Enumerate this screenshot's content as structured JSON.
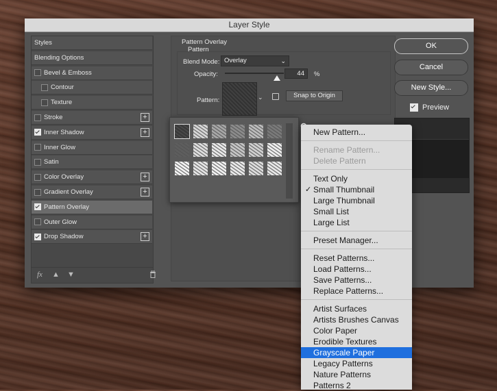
{
  "window": {
    "title": "Layer Style"
  },
  "styles_list": {
    "items": [
      {
        "label": "Styles",
        "checkbox": false,
        "checked": false,
        "plus": false,
        "indent": 0,
        "selected": false
      },
      {
        "label": "Blending Options",
        "checkbox": false,
        "checked": false,
        "plus": false,
        "indent": 0,
        "selected": false
      },
      {
        "label": "Bevel & Emboss",
        "checkbox": true,
        "checked": false,
        "plus": false,
        "indent": 0,
        "selected": false
      },
      {
        "label": "Contour",
        "checkbox": true,
        "checked": false,
        "plus": false,
        "indent": 1,
        "selected": false
      },
      {
        "label": "Texture",
        "checkbox": true,
        "checked": false,
        "plus": false,
        "indent": 1,
        "selected": false
      },
      {
        "label": "Stroke",
        "checkbox": true,
        "checked": false,
        "plus": true,
        "indent": 0,
        "selected": false
      },
      {
        "label": "Inner Shadow",
        "checkbox": true,
        "checked": true,
        "plus": true,
        "indent": 0,
        "selected": false
      },
      {
        "label": "Inner Glow",
        "checkbox": true,
        "checked": false,
        "plus": false,
        "indent": 0,
        "selected": false
      },
      {
        "label": "Satin",
        "checkbox": true,
        "checked": false,
        "plus": false,
        "indent": 0,
        "selected": false
      },
      {
        "label": "Color Overlay",
        "checkbox": true,
        "checked": false,
        "plus": true,
        "indent": 0,
        "selected": false
      },
      {
        "label": "Gradient Overlay",
        "checkbox": true,
        "checked": false,
        "plus": true,
        "indent": 0,
        "selected": false
      },
      {
        "label": "Pattern Overlay",
        "checkbox": true,
        "checked": true,
        "plus": false,
        "indent": 0,
        "selected": true
      },
      {
        "label": "Outer Glow",
        "checkbox": true,
        "checked": false,
        "plus": false,
        "indent": 0,
        "selected": false
      },
      {
        "label": "Drop Shadow",
        "checkbox": true,
        "checked": true,
        "plus": true,
        "indent": 0,
        "selected": false
      }
    ],
    "footer_fx": "fx"
  },
  "pattern_overlay": {
    "section_title": "Pattern Overlay",
    "group_title": "Pattern",
    "blend_mode_label": "Blend Mode:",
    "blend_mode_value": "Overlay",
    "opacity_label": "Opacity:",
    "opacity_value": "44",
    "opacity_unit": "%",
    "opacity_fraction": 0.44,
    "pattern_label": "Pattern:",
    "snap_button": "Snap to Origin"
  },
  "buttons": {
    "ok": "OK",
    "cancel": "Cancel",
    "new_style": "New Style...",
    "preview_label": "Preview",
    "preview_checked": true
  },
  "swatches": [
    "#3a3a3a",
    "#d8d8d8",
    "#a8a8a8",
    "#8c8c8c",
    "#bdbdbd",
    "#7a7a7a",
    "#5e5e5e",
    "#e0e0e0",
    "#eaeaea",
    "#c6c6c6",
    "#d2d2d2",
    "#f0f0f0",
    "#f4f4f4",
    "#e6e6e6",
    "#f2f2f2",
    "#ebebeb",
    "#dedede",
    "#e9e9e9"
  ],
  "menu": {
    "groups": [
      [
        {
          "label": "New Pattern...",
          "disabled": false
        }
      ],
      [
        {
          "label": "Rename Pattern...",
          "disabled": true
        },
        {
          "label": "Delete Pattern",
          "disabled": true
        }
      ],
      [
        {
          "label": "Text Only"
        },
        {
          "label": "Small Thumbnail",
          "checked": true
        },
        {
          "label": "Large Thumbnail"
        },
        {
          "label": "Small List"
        },
        {
          "label": "Large List"
        }
      ],
      [
        {
          "label": "Preset Manager..."
        }
      ],
      [
        {
          "label": "Reset Patterns..."
        },
        {
          "label": "Load Patterns..."
        },
        {
          "label": "Save Patterns..."
        },
        {
          "label": "Replace Patterns..."
        }
      ],
      [
        {
          "label": "Artist Surfaces"
        },
        {
          "label": "Artists Brushes Canvas"
        },
        {
          "label": "Color Paper"
        },
        {
          "label": "Erodible Textures"
        },
        {
          "label": "Grayscale Paper",
          "highlighted": true
        },
        {
          "label": "Legacy Patterns"
        },
        {
          "label": "Nature Patterns"
        },
        {
          "label": "Patterns 2"
        }
      ]
    ]
  },
  "colors": {
    "highlight": "#1f6fde",
    "dialog_bg": "#535353"
  },
  "icons": {
    "gear": "gear-icon",
    "arrow_up": "arrow-up-icon",
    "arrow_down": "arrow-down-icon",
    "trash": "trash-icon",
    "chevron": "chevron-down-icon"
  }
}
